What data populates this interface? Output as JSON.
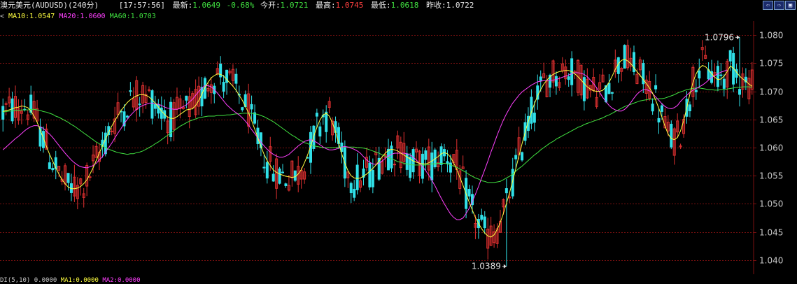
{
  "header": {
    "instrument": "澳元美元(AUDUSD)(240分)",
    "time": "[17:57:56]",
    "latest_label": "最新:",
    "latest_value": "1.0649",
    "change": "-0.68%",
    "open_label": "今开:",
    "open_value": "1.0721",
    "high_label": "最高:",
    "high_value": "1.0745",
    "low_label": "最低:",
    "low_value": "1.0618",
    "prevclose_label": "昨收:",
    "prevclose_value": "1.0722"
  },
  "ma_bar": {
    "ma10": "MA10:1.0547",
    "ma20": "MA20:1.0600",
    "ma60": "MA60:1.0703"
  },
  "nav_buttons": [
    "⇦",
    "⇨",
    "▣"
  ],
  "bottom_bar": {
    "indicator": "DI(5,10) 0.0000",
    "ma1": "MA1:0.0000",
    "ma2": "MA2:0.0000"
  },
  "colors": {
    "up": "#e03030",
    "down": "#30e0e8",
    "ma10": "#ffff40",
    "ma20": "#ff40ff",
    "ma60": "#40e040",
    "grid": "#7a1010",
    "axis_text": "#c8c8c8"
  },
  "chart_data": {
    "type": "candlestick",
    "ylim": [
      1.0375,
      1.0825
    ],
    "yticks": [
      "1.080",
      "1.075",
      "1.070",
      "1.065",
      "1.060",
      "1.055",
      "1.050",
      "1.045",
      "1.040"
    ],
    "annotations": [
      {
        "label": "1.0796",
        "value": 1.0796,
        "index": 237
      },
      {
        "label": "1.0389",
        "value": 1.0389,
        "index": 162
      }
    ],
    "series": [
      {
        "name": "MA10",
        "values": [
          1.0664,
          1.0666,
          1.0667,
          1.0669,
          1.0671,
          1.0672,
          1.0674,
          1.0673,
          1.0671,
          1.0665,
          1.0656,
          1.0645,
          1.0631,
          1.0617,
          1.0602,
          1.0588,
          1.0576,
          1.0564,
          1.0553,
          1.0543,
          1.0536,
          1.053,
          1.0527,
          1.0527,
          1.0528,
          1.0531,
          1.0536,
          1.0543,
          1.0553,
          1.0564,
          1.0577,
          1.059,
          1.0603,
          1.0615,
          1.0627,
          1.0638,
          1.0648,
          1.0657,
          1.0666,
          1.0673,
          1.068,
          1.0685,
          1.0689,
          1.0692,
          1.0694,
          1.0694,
          1.0693,
          1.069,
          1.0685,
          1.0679,
          1.0672,
          1.0665,
          1.0659,
          1.0654,
          1.0652,
          1.0652,
          1.0655,
          1.0659,
          1.0663,
          1.0667,
          1.0668,
          1.0669,
          1.0675,
          1.0684,
          1.0695,
          1.0707,
          1.0716,
          1.0724,
          1.0728,
          1.0731,
          1.073,
          1.0727,
          1.0721,
          1.0715,
          1.0709,
          1.0702,
          1.0693,
          1.0684,
          1.0673,
          1.0662,
          1.0648,
          1.0633,
          1.0617,
          1.0602,
          1.0588,
          1.0577,
          1.0568,
          1.056,
          1.0556,
          1.0553,
          1.0551,
          1.0549,
          1.0548,
          1.0547,
          1.0548,
          1.0553,
          1.0561,
          1.0573,
          1.0587,
          1.0603,
          1.062,
          1.0636,
          1.0649,
          1.0658,
          1.0661,
          1.0656,
          1.0644,
          1.0628,
          1.0608,
          1.0589,
          1.0572,
          1.0559,
          1.055,
          1.0546,
          1.0545,
          1.0546,
          1.0549,
          1.0553,
          1.0558,
          1.0563,
          1.0569,
          1.0576,
          1.0584,
          1.059,
          1.0595,
          1.0597,
          1.0596,
          1.0594,
          1.059,
          1.0587,
          1.0583,
          1.058,
          1.0576,
          1.0574,
          1.0572,
          1.0571,
          1.0571,
          1.0573,
          1.0576,
          1.058,
          1.0584,
          1.0589,
          1.0591,
          1.0589,
          1.0583,
          1.0573,
          1.0561,
          1.0547,
          1.0533,
          1.0518,
          1.0503,
          1.0489,
          1.0476,
          1.0465,
          1.0456,
          1.0448,
          1.0443,
          1.0441,
          1.0445,
          1.0454,
          1.0467,
          1.0483,
          1.0501,
          1.052,
          1.0541,
          1.0563,
          1.0585,
          1.0607,
          1.0627,
          1.0646,
          1.0663,
          1.0678,
          1.0692,
          1.0703,
          1.0713,
          1.072,
          1.0726,
          1.073,
          1.0733,
          1.0735,
          1.0736,
          1.0737,
          1.0737,
          1.0735,
          1.0731,
          1.0726,
          1.072,
          1.0714,
          1.0708,
          1.0704,
          1.0701,
          1.07,
          1.07,
          1.0702,
          1.0708,
          1.0716,
          1.0727,
          1.0739,
          1.0749,
          1.0755,
          1.0757,
          1.0754,
          1.0749,
          1.0742,
          1.0735,
          1.0728,
          1.0721,
          1.0714,
          1.0706,
          1.0697,
          1.0684,
          1.067,
          1.0654,
          1.0638,
          1.0624,
          1.0616,
          1.0614,
          1.0618,
          1.063,
          1.0648,
          1.0671,
          1.0695,
          1.0716,
          1.0731,
          1.0741,
          1.0746,
          1.0744,
          1.0738,
          1.0731,
          1.0725,
          1.0721,
          1.0722,
          1.0727,
          1.0735,
          1.0745,
          1.0741,
          1.0734,
          1.0727,
          1.0722,
          1.0718,
          1.0713,
          1.0709
        ]
      },
      {
        "name": "MA20",
        "values": [
          1.0596,
          1.0601,
          1.0606,
          1.0611,
          1.0616,
          1.062,
          1.0625,
          1.063,
          1.0634,
          1.0637,
          1.0639,
          1.0639,
          1.0637,
          1.0634,
          1.0629,
          1.0624,
          1.0618,
          1.0611,
          1.0604,
          1.0597,
          1.059,
          1.0584,
          1.0578,
          1.0573,
          1.0569,
          1.0566,
          1.0565,
          1.0564,
          1.0566,
          1.0568,
          1.0572,
          1.0578,
          1.0584,
          1.0592,
          1.06,
          1.0608,
          1.0617,
          1.0626,
          1.0634,
          1.0643,
          1.065,
          1.0657,
          1.0663,
          1.0668,
          1.0672,
          1.0675,
          1.0677,
          1.0679,
          1.0679,
          1.0678,
          1.0677,
          1.0675,
          1.0672,
          1.067,
          1.0669,
          1.0668,
          1.0668,
          1.067,
          1.0673,
          1.0676,
          1.0681,
          1.0686,
          1.0693,
          1.07,
          1.0706,
          1.071,
          1.071,
          1.0708,
          1.0703,
          1.0697,
          1.069,
          1.0683,
          1.0676,
          1.0671,
          1.0666,
          1.0662,
          1.0658,
          1.0653,
          1.0647,
          1.064,
          1.0632,
          1.0625,
          1.0617,
          1.061,
          1.0603,
          1.0597,
          1.0592,
          1.0588,
          1.0585,
          1.0583,
          1.0583,
          1.0585,
          1.0588,
          1.0593,
          1.0598,
          1.0603,
          1.0607,
          1.0611,
          1.0613,
          1.0614,
          1.0612,
          1.0609,
          1.0605,
          1.0601,
          1.0598,
          1.0596,
          1.0596,
          1.0597,
          1.0599,
          1.0601,
          1.0602,
          1.0601,
          1.0599,
          1.0597,
          1.0594,
          1.059,
          1.0584,
          1.0578,
          1.0574,
          1.0571,
          1.057,
          1.0572,
          1.0576,
          1.0581,
          1.0585,
          1.0588,
          1.059,
          1.059,
          1.059,
          1.059,
          1.0589,
          1.0587,
          1.0583,
          1.0578,
          1.0572,
          1.0566,
          1.0559,
          1.0551,
          1.0542,
          1.0532,
          1.0521,
          1.051,
          1.05,
          1.0491,
          1.0482,
          1.0476,
          1.0472,
          1.0472,
          1.0475,
          1.0483,
          1.0492,
          1.0504,
          1.0517,
          1.0531,
          1.0546,
          1.0561,
          1.0576,
          1.0592,
          1.0607,
          1.0622,
          1.0636,
          1.0649,
          1.066,
          1.067,
          1.0679,
          1.0686,
          1.0693,
          1.0699,
          1.0703,
          1.0707,
          1.0711,
          1.0714,
          1.0717,
          1.0718,
          1.0719,
          1.0719,
          1.0719,
          1.072,
          1.0721,
          1.0723,
          1.0725,
          1.0727,
          1.0729,
          1.0731,
          1.0733,
          1.0733,
          1.0732,
          1.073,
          1.0726,
          1.072,
          1.0714,
          1.0706,
          1.0698,
          1.0689,
          1.0682,
          1.0675,
          1.067,
          1.0667,
          1.0665,
          1.0665,
          1.0668,
          1.0673,
          1.068,
          1.0688,
          1.0695,
          1.07,
          1.0703,
          1.0703,
          1.0701,
          1.0696,
          1.069,
          1.0684,
          1.0678,
          1.0673,
          1.067,
          1.0669,
          1.0671,
          1.0675,
          1.0682,
          1.0688,
          1.0693,
          1.0698,
          1.0702,
          1.0705,
          1.0708,
          1.0711,
          1.0715,
          1.072,
          1.0724,
          1.0728,
          1.0731,
          1.0734,
          1.0736,
          1.0738
        ]
      },
      {
        "name": "MA60",
        "values": [
          1.0663,
          1.0664,
          1.0665,
          1.0665,
          1.0666,
          1.0666,
          1.0667,
          1.0667,
          1.0667,
          1.0668,
          1.0668,
          1.0667,
          1.0666,
          1.0664,
          1.0663,
          1.0661,
          1.0659,
          1.0656,
          1.0654,
          1.0651,
          1.0648,
          1.0645,
          1.0641,
          1.0638,
          1.0634,
          1.063,
          1.0626,
          1.0622,
          1.0618,
          1.0614,
          1.061,
          1.0607,
          1.0603,
          1.06,
          1.0597,
          1.0595,
          1.0593,
          1.0591,
          1.059,
          1.0589,
          1.0588,
          1.0589,
          1.0589,
          1.0591,
          1.0592,
          1.0594,
          1.0597,
          1.06,
          1.0603,
          1.0607,
          1.061,
          1.0614,
          1.0618,
          1.0622,
          1.0626,
          1.063,
          1.0634,
          1.0638,
          1.0641,
          1.0644,
          1.0647,
          1.0649,
          1.0651,
          1.0653,
          1.0654,
          1.0655,
          1.0656,
          1.0656,
          1.0656,
          1.0657,
          1.0657,
          1.0657,
          1.0658,
          1.0658,
          1.0659,
          1.066,
          1.066,
          1.0661,
          1.0661,
          1.0661,
          1.0661,
          1.066,
          1.0659,
          1.0657,
          1.0655,
          1.0652,
          1.0649,
          1.0646,
          1.0642,
          1.0638,
          1.0634,
          1.063,
          1.0626,
          1.0622,
          1.0619,
          1.0615,
          1.0612,
          1.0609,
          1.0607,
          1.0605,
          1.0603,
          1.0602,
          1.0601,
          1.06,
          1.06,
          1.06,
          1.06,
          1.06,
          1.0601,
          1.0601,
          1.0601,
          1.0601,
          1.0601,
          1.0601,
          1.06,
          1.06,
          1.0599,
          1.0598,
          1.0596,
          1.0594,
          1.0592,
          1.059,
          1.0587,
          1.0585,
          1.0582,
          1.058,
          1.0578,
          1.0575,
          1.0574,
          1.0572,
          1.0571,
          1.057,
          1.0569,
          1.0569,
          1.0569,
          1.0569,
          1.0569,
          1.057,
          1.0571,
          1.0571,
          1.0572,
          1.0572,
          1.0572,
          1.0571,
          1.0569,
          1.0567,
          1.0565,
          1.0562,
          1.0559,
          1.0556,
          1.0552,
          1.0549,
          1.0546,
          1.0544,
          1.0541,
          1.054,
          1.0538,
          1.0538,
          1.0538,
          1.0539,
          1.054,
          1.0543,
          1.0546,
          1.0549,
          1.0553,
          1.0558,
          1.0563,
          1.0567,
          1.0572,
          1.0577,
          1.0582,
          1.0587,
          1.0591,
          1.0596,
          1.06,
          1.0604,
          1.0608,
          1.0611,
          1.0615,
          1.0618,
          1.0621,
          1.0624,
          1.0627,
          1.063,
          1.0633,
          1.0636,
          1.0638,
          1.0641,
          1.0643,
          1.0645,
          1.0647,
          1.0649,
          1.0651,
          1.0653,
          1.0656,
          1.0658,
          1.0661,
          1.0664,
          1.0667,
          1.067,
          1.0673,
          1.0675,
          1.0677,
          1.0679,
          1.0681,
          1.0683,
          1.0684,
          1.0685,
          1.0686,
          1.0686,
          1.0686,
          1.0687,
          1.0687,
          1.0688,
          1.069,
          1.0692,
          1.0694,
          1.0697,
          1.0699,
          1.0701,
          1.0703,
          1.0704,
          1.0705,
          1.0706,
          1.0706,
          1.0705,
          1.0704,
          1.0703,
          1.0703,
          1.0702,
          1.0702,
          1.0703,
          1.0703,
          1.0704,
          1.0705,
          1.0706,
          1.0707,
          1.0707,
          1.0708,
          1.0708,
          1.0708,
          1.0707
        ]
      }
    ]
  }
}
